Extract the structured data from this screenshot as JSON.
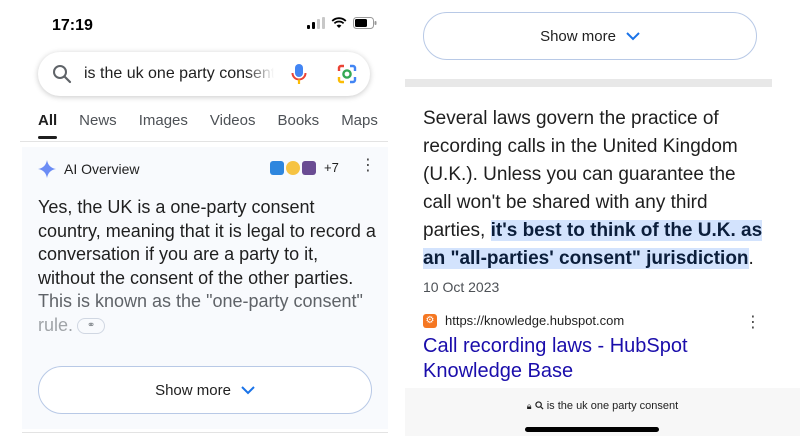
{
  "status": {
    "time": "17:19"
  },
  "search": {
    "query": "is the uk one party consent"
  },
  "tabs": [
    {
      "label": "All",
      "active": true
    },
    {
      "label": "News"
    },
    {
      "label": "Images"
    },
    {
      "label": "Videos"
    },
    {
      "label": "Books"
    },
    {
      "label": "Maps"
    }
  ],
  "ai_overview": {
    "label": "AI Overview",
    "more_sources": "+7",
    "text_main": "Yes, the UK is a one-party consent country, meaning that it is legal to record a conversation if you are a party to it, without the consent of the other parties.",
    "text_faded": " This is known as the \"one-party consent\"",
    "text_faded2": "rule.",
    "show_more": "Show more"
  },
  "right": {
    "show_more": "Show more",
    "snippet_plain": "Several laws govern the practice of recording calls in the United Kingdom (U.K.). Unless you can guarantee the call won't be shared with any third parties, ",
    "snippet_highlight": "it's best to think of the U.K. as an \"all-parties' consent\" jurisdiction",
    "snippet_end": ".",
    "date": "10 Oct 2023",
    "source_url": "https://knowledge.hubspot.com",
    "result_title": "Call recording laws - HubSpot Knowledge Base",
    "address_bar": "is the uk one party consent"
  },
  "colors": {
    "link": "#1a0dab",
    "highlight": "#d3e3fd",
    "hubspot": "#f57722"
  }
}
